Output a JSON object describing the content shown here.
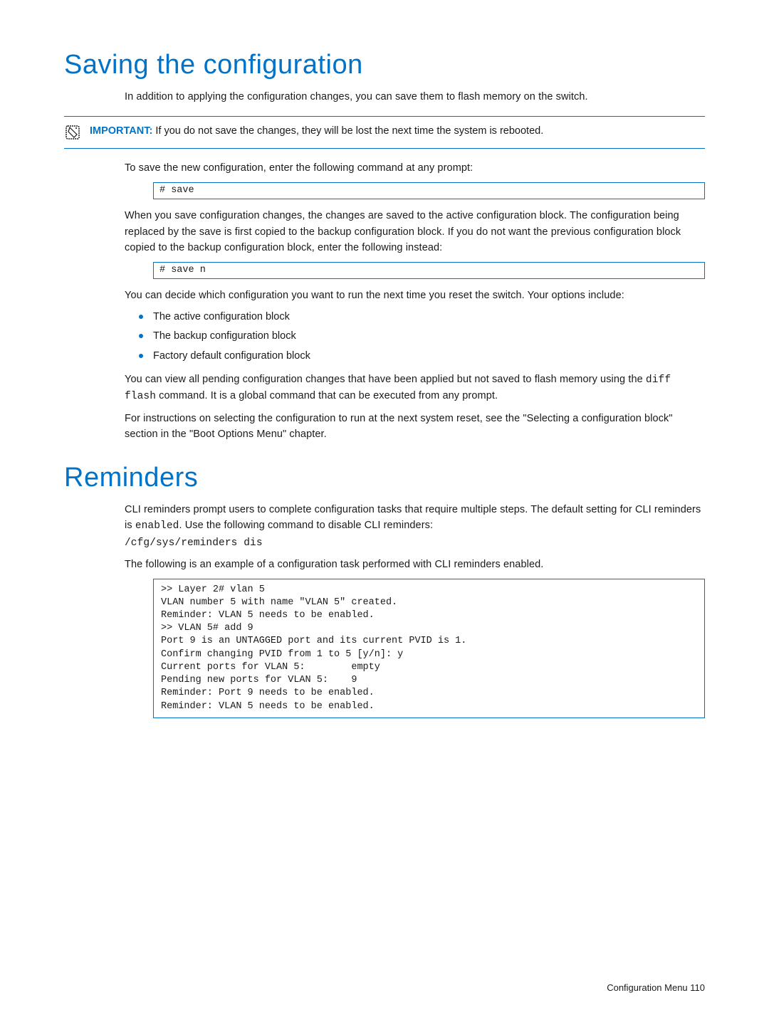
{
  "section1": {
    "title": "Saving the configuration",
    "intro": "In addition to applying the configuration changes, you can save them to flash memory on the switch.",
    "callout_label": "IMPORTANT:",
    "callout_text": " If you do not save the changes, they will be lost the next time the system is rebooted.",
    "para_save_intro": "To save the new configuration, enter the following command at any prompt:",
    "code_save": "# save",
    "para_after_save": "When you save configuration changes, the changes are saved to the active configuration block. The configuration being replaced by the save is first copied to the backup configuration block. If you do not want the previous configuration block copied to the backup configuration block, enter the following instead:",
    "code_save_n": "# save n",
    "para_options_intro": "You can decide which configuration you want to run the next time you reset the switch. Your options include:",
    "bullets": [
      "The active configuration block",
      "The backup configuration block",
      "Factory default configuration block"
    ],
    "para_diff_1": "You can view all pending configuration changes that have been applied but not saved to flash memory using the ",
    "para_diff_mono": "diff flash",
    "para_diff_2": " command. It is a global command that can be executed from any prompt.",
    "para_instructions": "For instructions on selecting the configuration to run at the next system reset, see the \"Selecting a configuration block\" section in the \"Boot Options Menu\" chapter."
  },
  "section2": {
    "title": "Reminders",
    "intro_1": "CLI reminders prompt users to complete configuration tasks that require multiple steps. The default setting for CLI reminders is ",
    "intro_mono1": "enabled",
    "intro_2": ". Use the following command to disable CLI reminders:",
    "cmd_line": "/cfg/sys/reminders dis",
    "example_intro": "The following is an example of a configuration task performed with CLI reminders enabled.",
    "code_block": ">> Layer 2# vlan 5\nVLAN number 5 with name \"VLAN 5\" created.\nReminder: VLAN 5 needs to be enabled.\n>> VLAN 5# add 9\nPort 9 is an UNTAGGED port and its current PVID is 1.\nConfirm changing PVID from 1 to 5 [y/n]: y\nCurrent ports for VLAN 5:        empty\nPending new ports for VLAN 5:    9\nReminder: Port 9 needs to be enabled.\nReminder: VLAN 5 needs to be enabled."
  },
  "footer": {
    "text": "Configuration Menu  110"
  }
}
